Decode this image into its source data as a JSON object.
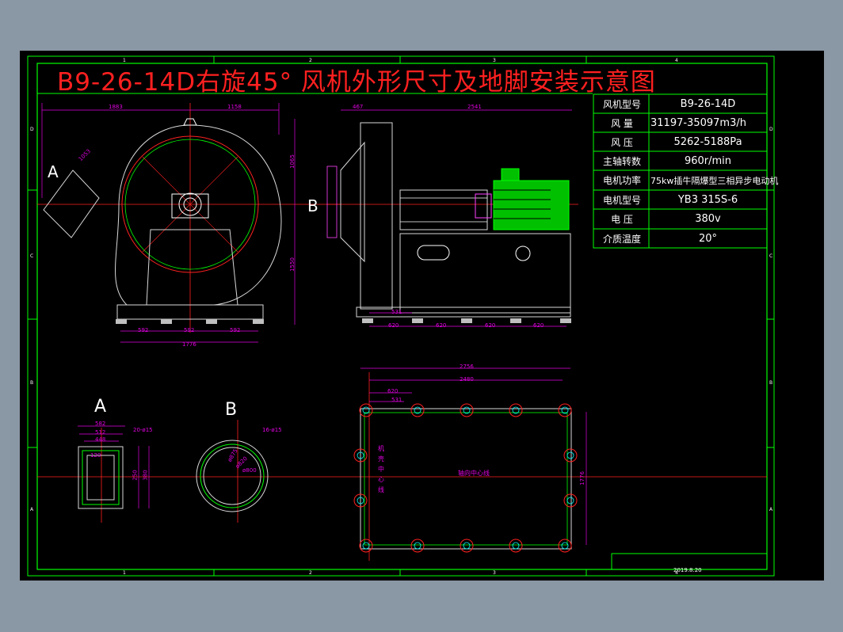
{
  "title": "B9-26-14D右旋45° 风机外形尺寸及地脚安装示意图",
  "specs": [
    {
      "label": "风机型号",
      "value": "B9-26-14D"
    },
    {
      "label": "风    量",
      "value": "31197-35097m3/h"
    },
    {
      "label": "风    压",
      "value": "5262-5188Pa"
    },
    {
      "label": "主轴转数",
      "value": "960r/min"
    },
    {
      "label": "电机功率",
      "value": "75kw插牛隔爆型三相异步电动机"
    },
    {
      "label": "电机型号",
      "value": "YB3 315S-6"
    },
    {
      "label": "电    压",
      "value": "380v"
    },
    {
      "label": "介质温度",
      "value": "20°"
    }
  ],
  "view_labels": {
    "a_side": "A",
    "b_side": "B",
    "a_detail": "A",
    "b_detail": "B"
  },
  "dimensions": {
    "front_top_left": "1883",
    "front_top_right": "1158",
    "front_diag": "1053",
    "front_height_upper": "1065",
    "front_height_lower": "1550",
    "front_bottom_1": "592",
    "front_bottom_2": "592",
    "front_bottom_3": "592",
    "front_bottom_total": "1776",
    "side_top_left": "467",
    "side_top_right": "2541",
    "side_bottom_531": "531",
    "side_bottom_1": "620",
    "side_bottom_2": "620",
    "side_bottom_3": "620",
    "side_bottom_4": "620",
    "plan_total": "2756",
    "plan_inner": "2480",
    "plan_620": "620",
    "plan_531": "531",
    "plan_height": "1776",
    "a_w1": "582",
    "a_w2": "512",
    "a_w3": "448",
    "a_holes": "20-ø15",
    "a_h1": "250",
    "a_h2": "380",
    "a_h3": "120",
    "b_holes": "16-ø15",
    "b_d1": "ø875",
    "b_d2": "ø820",
    "b_d3": "ø800"
  },
  "plan_labels": {
    "axis": "轴向中心线",
    "machine_center": "机壳中心线"
  },
  "date": "2019.8.20",
  "grid_cols": [
    "1",
    "2",
    "3",
    "4"
  ],
  "grid_rows": [
    "D",
    "C",
    "B",
    "A"
  ]
}
